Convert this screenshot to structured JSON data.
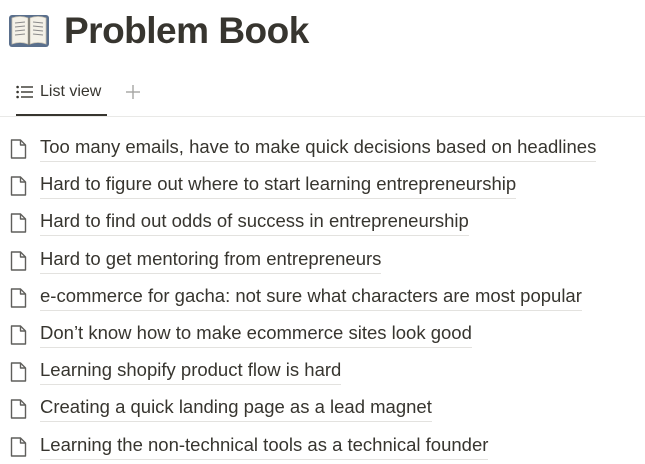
{
  "header": {
    "icon": "open-book-emoji",
    "title": "Problem Book"
  },
  "tabs": [
    {
      "label": "List view",
      "icon": "list-icon",
      "active": true
    }
  ],
  "add_view_icon": "plus-icon",
  "items": [
    {
      "icon": "document-icon",
      "title": "Too many emails, have to make quick decisions based on headlines"
    },
    {
      "icon": "document-icon",
      "title": "Hard to figure out where to start learning entrepreneurship"
    },
    {
      "icon": "document-icon",
      "title": "Hard to find out odds of success in entrepreneurship"
    },
    {
      "icon": "document-icon",
      "title": "Hard to get mentoring from entrepreneurs"
    },
    {
      "icon": "document-icon",
      "title": "e-commerce for gacha: not sure what characters are most popular"
    },
    {
      "icon": "document-icon",
      "title": "Don’t know how to make ecommerce sites look good"
    },
    {
      "icon": "document-icon",
      "title": "Learning shopify product flow is hard"
    },
    {
      "icon": "document-icon",
      "title": "Creating a quick landing page as a lead magnet"
    },
    {
      "icon": "document-icon",
      "title": "Learning the non-technical tools as a technical founder"
    }
  ]
}
